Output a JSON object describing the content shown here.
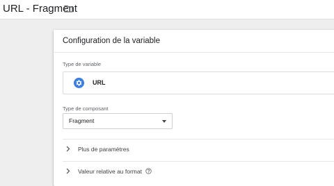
{
  "header": {
    "title": "URL - Fragment",
    "folder_icon": "folder-icon"
  },
  "card": {
    "title": "Configuration de la variable",
    "variable_type": {
      "label": "Type de variable",
      "icon": "gear-icon",
      "icon_color": "#3b7de2",
      "value": "URL"
    },
    "component_type": {
      "label": "Type de composant",
      "selected": "Fragment"
    },
    "sections": [
      {
        "label": "Plus de paramètres",
        "icon": "chevron-right-icon"
      },
      {
        "label": "Valeur relative au format",
        "icon": "chevron-right-icon",
        "help_icon": "help-icon"
      }
    ]
  }
}
